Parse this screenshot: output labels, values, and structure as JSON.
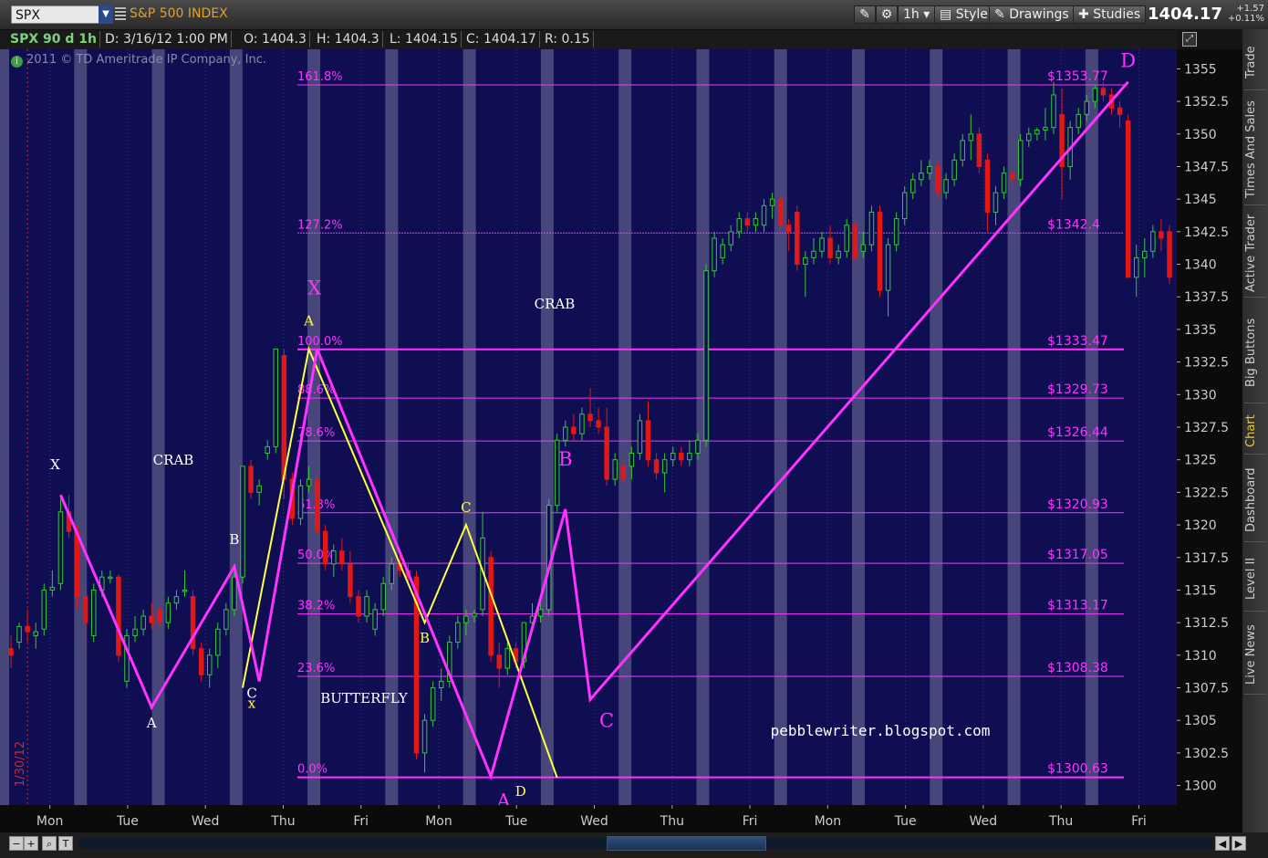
{
  "toolbar": {
    "symbol": "SPX",
    "symbol_name": "S&P 500 INDEX",
    "timeframe": "1h",
    "style_label": "Style",
    "drawings_label": "Drawings",
    "studies_label": "Studies",
    "last_price": "1404.17",
    "change_abs": "+1.57",
    "change_pct": "+0.11%"
  },
  "info_bar": {
    "chart_id": "SPX 90 d 1h",
    "date": "D: 3/16/12 1:00 PM",
    "open": "O: 1404.3",
    "high": "H: 1404.3",
    "low": "L: 1404.15",
    "close": "C: 1404.17",
    "range": "R: 0.15"
  },
  "copyright": "2011 © TD Ameritrade IP Company, Inc.",
  "sidebar_tabs": [
    "Trade",
    "Times And Sales",
    "Active Trader",
    "Big Buttons",
    "Chart",
    "Dashboard",
    "Level II",
    "Live News"
  ],
  "active_tab": "Chart",
  "colors": {
    "background": "#0f0e52",
    "up_candle": "#33c833",
    "down_candle": "#e01818",
    "harmonic": "#ff33ff",
    "butterfly": "#ffff44",
    "shading": "#5a5a88"
  },
  "chart_data": {
    "type": "candlestick",
    "ylim": [
      1298.5,
      1356.5
    ],
    "yticks": [
      1300,
      1302.5,
      1305,
      1307.5,
      1310,
      1312.5,
      1315,
      1317.5,
      1320,
      1322.5,
      1325,
      1327.5,
      1330,
      1332.5,
      1335,
      1337.5,
      1340,
      1342.5,
      1345,
      1347.5,
      1350,
      1352.5,
      1355
    ],
    "days": [
      "Mon",
      "Tue",
      "Wed",
      "Thu",
      "Fri",
      "Mon",
      "Tue",
      "Wed",
      "Thu",
      "Fri",
      "Mon",
      "Tue",
      "Wed",
      "Thu",
      "Fri"
    ],
    "vertical_date_label": "1/30/12",
    "candles": [
      {
        "o": 1310.5,
        "h": 1311.5,
        "l": 1309.0,
        "c": 1310.0
      },
      {
        "o": 1311.0,
        "h": 1312.5,
        "l": 1310.5,
        "c": 1312.2
      },
      {
        "o": 1312.2,
        "h": 1313.5,
        "l": 1311.0,
        "c": 1311.8
      },
      {
        "o": 1311.5,
        "h": 1312.5,
        "l": 1310.5,
        "c": 1311.8
      },
      {
        "o": 1312.0,
        "h": 1315.5,
        "l": 1311.5,
        "c": 1315.0
      },
      {
        "o": 1315.0,
        "h": 1316.5,
        "l": 1314.5,
        "c": 1315.2
      },
      {
        "o": 1315.5,
        "h": 1322.0,
        "l": 1315.0,
        "c": 1321.0
      },
      {
        "o": 1321.0,
        "h": 1322.3,
        "l": 1319.0,
        "c": 1319.5
      },
      {
        "o": 1319.5,
        "h": 1320.0,
        "l": 1313.5,
        "c": 1314.5
      },
      {
        "o": 1314.5,
        "h": 1315.0,
        "l": 1310.5,
        "c": 1312.5
      },
      {
        "o": 1311.5,
        "h": 1315.5,
        "l": 1311.0,
        "c": 1315.0
      },
      {
        "o": 1315.0,
        "h": 1316.5,
        "l": 1314.5,
        "c": 1316.0
      },
      {
        "o": 1316.0,
        "h": 1316.5,
        "l": 1315.5,
        "c": 1316.0
      },
      {
        "o": 1316.0,
        "h": 1316.2,
        "l": 1309.5,
        "c": 1310.0
      },
      {
        "o": 1308.0,
        "h": 1312.0,
        "l": 1307.5,
        "c": 1311.5
      },
      {
        "o": 1311.5,
        "h": 1313.0,
        "l": 1311.0,
        "c": 1312.0
      },
      {
        "o": 1312.0,
        "h": 1313.5,
        "l": 1311.5,
        "c": 1313.0
      },
      {
        "o": 1313.0,
        "h": 1314.0,
        "l": 1312.0,
        "c": 1312.5
      },
      {
        "o": 1313.5,
        "h": 1314.0,
        "l": 1312.0,
        "c": 1312.5
      },
      {
        "o": 1312.5,
        "h": 1314.5,
        "l": 1312.0,
        "c": 1314.0
      },
      {
        "o": 1314.0,
        "h": 1315.0,
        "l": 1313.5,
        "c": 1314.5
      },
      {
        "o": 1315.0,
        "h": 1316.5,
        "l": 1314.5,
        "c": 1315.0
      },
      {
        "o": 1314.5,
        "h": 1315.0,
        "l": 1310.0,
        "c": 1310.5
      },
      {
        "o": 1310.5,
        "h": 1311.0,
        "l": 1308.0,
        "c": 1308.5
      },
      {
        "o": 1308.5,
        "h": 1310.5,
        "l": 1307.5,
        "c": 1310.0
      },
      {
        "o": 1310.0,
        "h": 1312.5,
        "l": 1309.0,
        "c": 1312.0
      },
      {
        "o": 1312.0,
        "h": 1314.0,
        "l": 1311.5,
        "c": 1313.5
      },
      {
        "o": 1313.5,
        "h": 1316.5,
        "l": 1313.0,
        "c": 1316.0
      },
      {
        "o": 1316.0,
        "h": 1324.5,
        "l": 1315.5,
        "c": 1324.5
      },
      {
        "o": 1324.5,
        "h": 1325.0,
        "l": 1322.0,
        "c": 1322.5
      },
      {
        "o": 1322.5,
        "h": 1323.5,
        "l": 1321.5,
        "c": 1323.0
      },
      {
        "o": 1325.5,
        "h": 1326.5,
        "l": 1325.0,
        "c": 1326.0
      },
      {
        "o": 1326.0,
        "h": 1333.5,
        "l": 1325.5,
        "c": 1333.5
      },
      {
        "o": 1333.0,
        "h": 1333.5,
        "l": 1322.0,
        "c": 1323.5
      },
      {
        "o": 1323.5,
        "h": 1324.0,
        "l": 1320.0,
        "c": 1320.5
      },
      {
        "o": 1320.5,
        "h": 1323.5,
        "l": 1320.0,
        "c": 1323.0
      },
      {
        "o": 1323.0,
        "h": 1324.5,
        "l": 1322.5,
        "c": 1323.5
      },
      {
        "o": 1323.5,
        "h": 1324.0,
        "l": 1319.0,
        "c": 1319.5
      },
      {
        "o": 1319.5,
        "h": 1320.0,
        "l": 1316.5,
        "c": 1317.0
      },
      {
        "o": 1317.0,
        "h": 1318.5,
        "l": 1316.0,
        "c": 1318.0
      },
      {
        "o": 1318.0,
        "h": 1319.0,
        "l": 1316.5,
        "c": 1317.0
      },
      {
        "o": 1317.0,
        "h": 1318.0,
        "l": 1314.0,
        "c": 1314.5
      },
      {
        "o": 1314.5,
        "h": 1315.0,
        "l": 1312.5,
        "c": 1313.0
      },
      {
        "o": 1313.0,
        "h": 1315.0,
        "l": 1312.5,
        "c": 1314.5
      },
      {
        "o": 1312.0,
        "h": 1314.0,
        "l": 1311.5,
        "c": 1313.5
      },
      {
        "o": 1313.5,
        "h": 1316.0,
        "l": 1313.0,
        "c": 1315.5
      },
      {
        "o": 1315.5,
        "h": 1317.5,
        "l": 1315.0,
        "c": 1317.0
      },
      {
        "o": 1317.0,
        "h": 1318.0,
        "l": 1316.0,
        "c": 1316.5
      },
      {
        "o": 1316.5,
        "h": 1317.0,
        "l": 1315.5,
        "c": 1316.0
      },
      {
        "o": 1316.0,
        "h": 1316.5,
        "l": 1302.0,
        "c": 1302.5
      },
      {
        "o": 1302.5,
        "h": 1305.5,
        "l": 1301.0,
        "c": 1305.0
      },
      {
        "o": 1305.0,
        "h": 1308.0,
        "l": 1304.5,
        "c": 1307.5
      },
      {
        "o": 1307.5,
        "h": 1309.0,
        "l": 1306.5,
        "c": 1308.0
      },
      {
        "o": 1308.0,
        "h": 1311.5,
        "l": 1307.5,
        "c": 1311.0
      },
      {
        "o": 1311.0,
        "h": 1313.0,
        "l": 1310.5,
        "c": 1312.5
      },
      {
        "o": 1312.5,
        "h": 1313.5,
        "l": 1311.5,
        "c": 1313.0
      },
      {
        "o": 1313.0,
        "h": 1313.5,
        "l": 1312.5,
        "c": 1313.2
      },
      {
        "o": 1313.5,
        "h": 1321.0,
        "l": 1313.0,
        "c": 1319.0
      },
      {
        "o": 1317.5,
        "h": 1318.0,
        "l": 1309.5,
        "c": 1310.0
      },
      {
        "o": 1310.0,
        "h": 1311.0,
        "l": 1307.5,
        "c": 1309.0
      },
      {
        "o": 1309.0,
        "h": 1311.0,
        "l": 1308.5,
        "c": 1310.5
      },
      {
        "o": 1310.5,
        "h": 1311.0,
        "l": 1309.0,
        "c": 1309.5
      },
      {
        "o": 1309.5,
        "h": 1312.5,
        "l": 1309.0,
        "c": 1312.5
      },
      {
        "o": 1312.5,
        "h": 1314.0,
        "l": 1312.0,
        "c": 1313.0
      },
      {
        "o": 1313.0,
        "h": 1314.0,
        "l": 1312.5,
        "c": 1313.5
      },
      {
        "o": 1313.5,
        "h": 1322.0,
        "l": 1313.0,
        "c": 1321.5
      },
      {
        "o": 1321.5,
        "h": 1327.0,
        "l": 1321.0,
        "c": 1326.5
      },
      {
        "o": 1326.5,
        "h": 1328.0,
        "l": 1326.0,
        "c": 1327.5
      },
      {
        "o": 1327.5,
        "h": 1328.5,
        "l": 1326.5,
        "c": 1327.0
      },
      {
        "o": 1327.0,
        "h": 1329.0,
        "l": 1326.5,
        "c": 1328.5
      },
      {
        "o": 1328.5,
        "h": 1330.5,
        "l": 1327.5,
        "c": 1328.0
      },
      {
        "o": 1328.0,
        "h": 1329.0,
        "l": 1327.0,
        "c": 1327.5
      },
      {
        "o": 1327.5,
        "h": 1329.0,
        "l": 1323.0,
        "c": 1323.5
      },
      {
        "o": 1323.5,
        "h": 1325.5,
        "l": 1323.0,
        "c": 1325.0
      },
      {
        "o": 1324.5,
        "h": 1325.0,
        "l": 1323.0,
        "c": 1323.5
      },
      {
        "o": 1324.5,
        "h": 1326.0,
        "l": 1323.5,
        "c": 1325.5
      },
      {
        "o": 1325.5,
        "h": 1328.5,
        "l": 1325.0,
        "c": 1328.0
      },
      {
        "o": 1328.0,
        "h": 1329.5,
        "l": 1324.5,
        "c": 1325.0
      },
      {
        "o": 1325.0,
        "h": 1325.5,
        "l": 1323.5,
        "c": 1324.0
      },
      {
        "o": 1324.0,
        "h": 1325.5,
        "l": 1322.5,
        "c": 1325.0
      },
      {
        "o": 1325.0,
        "h": 1326.0,
        "l": 1324.5,
        "c": 1325.5
      },
      {
        "o": 1325.5,
        "h": 1326.0,
        "l": 1324.5,
        "c": 1325.0
      },
      {
        "o": 1325.0,
        "h": 1326.5,
        "l": 1324.5,
        "c": 1325.5
      },
      {
        "o": 1325.5,
        "h": 1327.0,
        "l": 1325.0,
        "c": 1326.5
      },
      {
        "o": 1326.5,
        "h": 1340.0,
        "l": 1326.0,
        "c": 1339.5
      },
      {
        "o": 1339.5,
        "h": 1342.5,
        "l": 1339.0,
        "c": 1342.0
      },
      {
        "o": 1340.5,
        "h": 1342.0,
        "l": 1340.0,
        "c": 1341.5
      },
      {
        "o": 1341.5,
        "h": 1343.0,
        "l": 1341.0,
        "c": 1342.5
      },
      {
        "o": 1342.5,
        "h": 1344.0,
        "l": 1342.0,
        "c": 1343.5
      },
      {
        "o": 1343.5,
        "h": 1344.0,
        "l": 1342.5,
        "c": 1343.0
      },
      {
        "o": 1343.0,
        "h": 1344.0,
        "l": 1342.5,
        "c": 1343.5
      },
      {
        "o": 1343.0,
        "h": 1345.0,
        "l": 1342.5,
        "c": 1344.5
      },
      {
        "o": 1344.5,
        "h": 1345.5,
        "l": 1343.5,
        "c": 1345.0
      },
      {
        "o": 1345.0,
        "h": 1345.5,
        "l": 1342.5,
        "c": 1343.0
      },
      {
        "o": 1343.0,
        "h": 1343.5,
        "l": 1341.0,
        "c": 1342.5
      },
      {
        "o": 1344.0,
        "h": 1344.5,
        "l": 1339.5,
        "c": 1340.0
      },
      {
        "o": 1340.0,
        "h": 1341.0,
        "l": 1337.5,
        "c": 1340.5
      },
      {
        "o": 1340.5,
        "h": 1342.0,
        "l": 1340.0,
        "c": 1341.0
      },
      {
        "o": 1341.0,
        "h": 1342.5,
        "l": 1340.5,
        "c": 1342.0
      },
      {
        "o": 1342.0,
        "h": 1343.0,
        "l": 1340.0,
        "c": 1340.5
      },
      {
        "o": 1340.5,
        "h": 1341.5,
        "l": 1340.0,
        "c": 1341.0
      },
      {
        "o": 1341.0,
        "h": 1343.5,
        "l": 1340.5,
        "c": 1343.0
      },
      {
        "o": 1343.0,
        "h": 1343.5,
        "l": 1340.0,
        "c": 1340.5
      },
      {
        "o": 1341.0,
        "h": 1342.5,
        "l": 1340.5,
        "c": 1341.5
      },
      {
        "o": 1341.5,
        "h": 1344.5,
        "l": 1341.0,
        "c": 1344.0
      },
      {
        "o": 1344.0,
        "h": 1344.5,
        "l": 1337.5,
        "c": 1338.0
      },
      {
        "o": 1338.0,
        "h": 1342.0,
        "l": 1336.0,
        "c": 1341.5
      },
      {
        "o": 1341.5,
        "h": 1344.0,
        "l": 1341.0,
        "c": 1343.5
      },
      {
        "o": 1343.5,
        "h": 1346.0,
        "l": 1343.0,
        "c": 1345.5
      },
      {
        "o": 1345.5,
        "h": 1347.0,
        "l": 1345.0,
        "c": 1346.5
      },
      {
        "o": 1346.5,
        "h": 1348.0,
        "l": 1346.0,
        "c": 1347.0
      },
      {
        "o": 1347.0,
        "h": 1348.0,
        "l": 1346.5,
        "c": 1347.5
      },
      {
        "o": 1347.5,
        "h": 1348.0,
        "l": 1345.0,
        "c": 1345.5
      },
      {
        "o": 1345.5,
        "h": 1347.0,
        "l": 1345.0,
        "c": 1346.5
      },
      {
        "o": 1346.5,
        "h": 1348.5,
        "l": 1346.0,
        "c": 1348.0
      },
      {
        "o": 1348.0,
        "h": 1350.0,
        "l": 1347.5,
        "c": 1349.5
      },
      {
        "o": 1349.5,
        "h": 1351.5,
        "l": 1348.0,
        "c": 1350.0
      },
      {
        "o": 1350.0,
        "h": 1350.5,
        "l": 1347.0,
        "c": 1347.5
      },
      {
        "o": 1348.0,
        "h": 1348.5,
        "l": 1342.5,
        "c": 1344.0
      },
      {
        "o": 1344.0,
        "h": 1346.0,
        "l": 1343.0,
        "c": 1345.5
      },
      {
        "o": 1345.5,
        "h": 1347.5,
        "l": 1345.0,
        "c": 1347.0
      },
      {
        "o": 1347.0,
        "h": 1347.5,
        "l": 1345.5,
        "c": 1346.5
      },
      {
        "o": 1346.5,
        "h": 1350.0,
        "l": 1346.0,
        "c": 1349.5
      },
      {
        "o": 1349.5,
        "h": 1350.5,
        "l": 1349.0,
        "c": 1350.0
      },
      {
        "o": 1350.0,
        "h": 1350.5,
        "l": 1349.5,
        "c": 1350.3
      },
      {
        "o": 1350.3,
        "h": 1352.0,
        "l": 1349.5,
        "c": 1350.5
      },
      {
        "o": 1350.5,
        "h": 1354.0,
        "l": 1350.0,
        "c": 1353.0
      },
      {
        "o": 1351.5,
        "h": 1353.5,
        "l": 1345.0,
        "c": 1347.5
      },
      {
        "o": 1347.5,
        "h": 1351.0,
        "l": 1346.5,
        "c": 1350.5
      },
      {
        "o": 1350.5,
        "h": 1352.0,
        "l": 1350.0,
        "c": 1351.5
      },
      {
        "o": 1351.5,
        "h": 1353.0,
        "l": 1351.0,
        "c": 1352.5
      },
      {
        "o": 1352.5,
        "h": 1353.8,
        "l": 1352.0,
        "c": 1353.5
      },
      {
        "o": 1353.5,
        "h": 1354.0,
        "l": 1352.5,
        "c": 1353.0
      },
      {
        "o": 1353.0,
        "h": 1353.5,
        "l": 1351.5,
        "c": 1352.0
      },
      {
        "o": 1352.0,
        "h": 1352.5,
        "l": 1350.5,
        "c": 1351.5
      },
      {
        "o": 1351.0,
        "h": 1351.5,
        "l": 1340.0,
        "c": 1339.0
      },
      {
        "o": 1339.0,
        "h": 1341.5,
        "l": 1337.5,
        "c": 1340.5
      },
      {
        "o": 1340.5,
        "h": 1342.0,
        "l": 1339.0,
        "c": 1341.0
      },
      {
        "o": 1341.0,
        "h": 1343.0,
        "l": 1340.5,
        "c": 1342.5
      },
      {
        "o": 1342.5,
        "h": 1343.5,
        "l": 1341.0,
        "c": 1342.0
      },
      {
        "o": 1342.5,
        "h": 1343.0,
        "l": 1338.5,
        "c": 1339.0
      }
    ],
    "fib_levels": [
      {
        "label": "161.8%",
        "value": 1353.77,
        "price": "$1353.77"
      },
      {
        "label": "127.2%",
        "value": 1342.4,
        "price": "$1342.4"
      },
      {
        "label": "100.0%",
        "value": 1333.47,
        "price": "$1333.47"
      },
      {
        "label": "88.6%",
        "value": 1329.73,
        "price": "$1329.73"
      },
      {
        "label": "78.6%",
        "value": 1326.44,
        "price": "$1326.44"
      },
      {
        "label": "61.8%",
        "value": 1320.93,
        "price": "$1320.93"
      },
      {
        "label": "50.0%",
        "value": 1317.05,
        "price": "$1317.05"
      },
      {
        "label": "38.2%",
        "value": 1313.17,
        "price": "$1313.17"
      },
      {
        "label": "23.6%",
        "value": 1308.38,
        "price": "$1308.38"
      },
      {
        "label": "0.0%",
        "value": 1300.63,
        "price": "$1300.63"
      }
    ],
    "pattern_magenta_1": [
      {
        "i": 6,
        "v": 1322.3,
        "label": "X"
      },
      {
        "i": 17,
        "v": 1306.0,
        "label": "A"
      },
      {
        "i": 27,
        "v": 1316.8,
        "label": "B"
      },
      {
        "i": 30,
        "v": 1308.0,
        "label": "C"
      },
      {
        "i": 37,
        "v": 1333.5,
        "label": ""
      }
    ],
    "pattern_magenta_2": [
      {
        "i": 37,
        "v": 1333.5,
        "label": "X"
      },
      {
        "i": 58,
        "v": 1300.7,
        "label": "A"
      },
      {
        "i": 67,
        "v": 1321.2,
        "label": "B"
      },
      {
        "i": 70,
        "v": 1306.6,
        "label": "C"
      },
      {
        "i": 135,
        "v": 1354.0,
        "label": "D"
      }
    ],
    "pattern_yellow": [
      {
        "i": 28,
        "v": 1307.5,
        "label": "x"
      },
      {
        "i": 36,
        "v": 1333.5,
        "label": "A"
      },
      {
        "i": 50,
        "v": 1312.5,
        "label": "B"
      },
      {
        "i": 55,
        "v": 1320.0,
        "label": "C"
      },
      {
        "i": 66,
        "v": 1300.6,
        "label": "D"
      }
    ],
    "annotations": [
      "CRAB",
      "CRAB",
      "BUTTERFLY",
      "pebblewriter.blogspot.com"
    ]
  }
}
